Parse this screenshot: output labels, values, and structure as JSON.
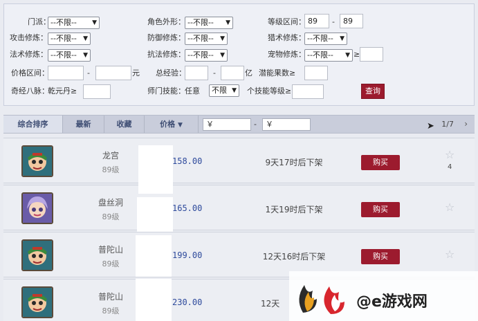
{
  "filters": {
    "school_label": "门派：",
    "school_value": "--不限--",
    "appearance_label": "角色外形：",
    "appearance_value": "--不限--",
    "level_label": "等级区间：",
    "level_min": "89",
    "level_sep": "-",
    "level_max": "89",
    "attack_label": "攻击修炼：",
    "attack_value": "--不限--",
    "defense_label": "防御修炼：",
    "defense_value": "--不限--",
    "hunt_label": "猎术修炼：",
    "hunt_value": "--不限--",
    "magic_label": "法术修炼：",
    "magic_value": "--不限--",
    "resist_label": "抗法修炼：",
    "resist_value": "--不限--",
    "pet_label": "宠物修炼：",
    "pet_value": "--不限--",
    "pet_ge": "≥",
    "price_label": "价格区间：",
    "price_sep": "-",
    "price_unit": "元",
    "exp_label": "总经验：",
    "exp_sep": "-",
    "exp_unit": "亿",
    "potential_label": "潜能果数≥",
    "meridian_label": "奇经八脉：",
    "meridian_sub": "乾元丹≥",
    "skill_label": "师门技能：",
    "skill_any": "任意",
    "skill_value": "不限",
    "skill_level_label": "个技能等级≥",
    "query_button": "查询"
  },
  "sortbar": {
    "tabs": [
      "综合排序",
      "最新",
      "收藏",
      "价格"
    ],
    "price_from": "￥",
    "price_sep": "-",
    "price_to": "￥",
    "pager": "1/7"
  },
  "listings": [
    {
      "school": "龙宫",
      "level": "89级",
      "price": "158.00",
      "delist": "9天17时后下架",
      "buy": "购买",
      "favorites": "4"
    },
    {
      "school": "盘丝洞",
      "level": "89级",
      "price": "165.00",
      "delist": "1天19时后下架",
      "buy": "购买",
      "favorites": ""
    },
    {
      "school": "普陀山",
      "level": "89级",
      "price": "199.00",
      "delist": "12天16时后下架",
      "buy": "购买",
      "favorites": ""
    },
    {
      "school": "普陀山",
      "level": "89级",
      "price": "230.00",
      "delist": "12天",
      "buy": "",
      "favorites": ""
    }
  ],
  "watermark": {
    "text": "@e游戏网"
  },
  "colors": {
    "accent": "#9c1b2e",
    "price": "#2e4a9c",
    "sortbar": "#c9cddb"
  }
}
